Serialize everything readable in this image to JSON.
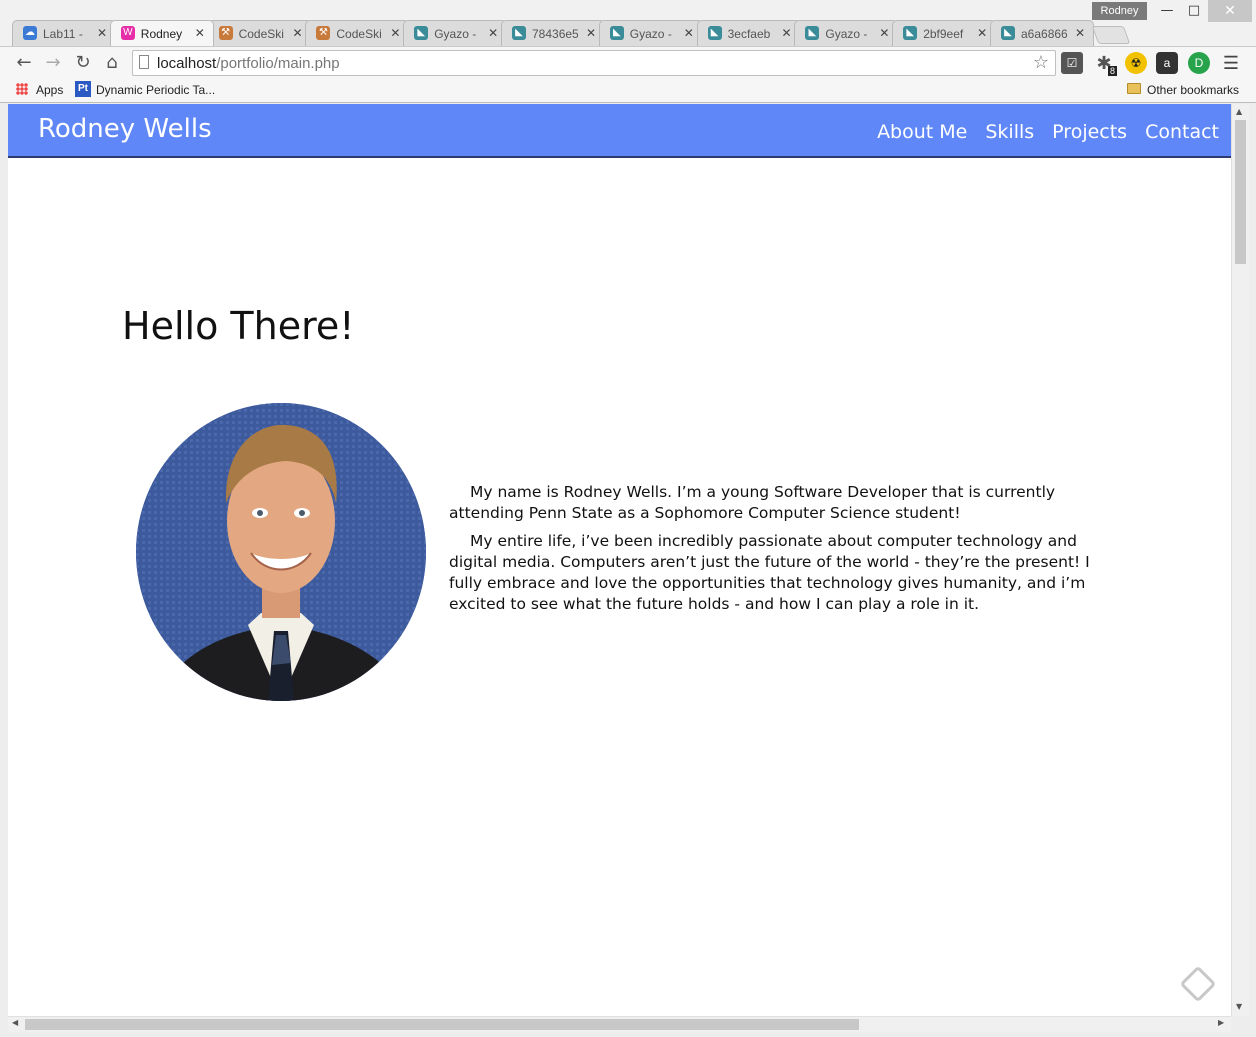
{
  "browser": {
    "user": "Rodney",
    "tabs": [
      {
        "title": "Lab11 -",
        "icon": "cloud-icon",
        "color": "#3b7bd6"
      },
      {
        "title": "Rodney",
        "icon": "wamp-icon",
        "color": "#e62ea8"
      },
      {
        "title": "CodeSki",
        "icon": "hammer-icon",
        "color": "#c87a3a"
      },
      {
        "title": "CodeSki",
        "icon": "hammer-icon",
        "color": "#c87a3a"
      },
      {
        "title": "Gyazo -",
        "icon": "gyazo-icon",
        "color": "#3a8c99"
      },
      {
        "title": "78436e5",
        "icon": "gyazo-icon",
        "color": "#3a8c99"
      },
      {
        "title": "Gyazo -",
        "icon": "gyazo-icon",
        "color": "#3a8c99"
      },
      {
        "title": "3ecfaeb",
        "icon": "gyazo-icon",
        "color": "#3a8c99"
      },
      {
        "title": "Gyazo -",
        "icon": "gyazo-icon",
        "color": "#3a8c99"
      },
      {
        "title": "2bf9eef",
        "icon": "gyazo-icon",
        "color": "#3a8c99"
      },
      {
        "title": "a6a6866",
        "icon": "gyazo-icon",
        "color": "#3a8c99"
      }
    ],
    "active_tab_index": 1,
    "url_host": "localhost",
    "url_path": "/portfolio/main.php",
    "extension_badge": "8",
    "bookmarks": {
      "apps": "Apps",
      "item1": "Dynamic Periodic Ta...",
      "item1_icon_text": "Pt",
      "other": "Other bookmarks"
    }
  },
  "site": {
    "brand": "Rodney Wells",
    "nav": [
      "About Me",
      "Skills",
      "Projects",
      "Contact"
    ],
    "nav_color": "#5f87f7",
    "heading": "Hello There!",
    "bio": [
      "My name is Rodney Wells. I’m a young Software Developer that is currently attending Penn State as a Sophomore Computer Science student!",
      "My entire life, i’ve been incredibly passionate about computer technology and digital media. Computers aren’t just the future of the world - they’re the present! I fully embrace and love the opportunities that technology gives humanity, and i’m excited to see what the future holds - and how I can play a role in it."
    ]
  }
}
